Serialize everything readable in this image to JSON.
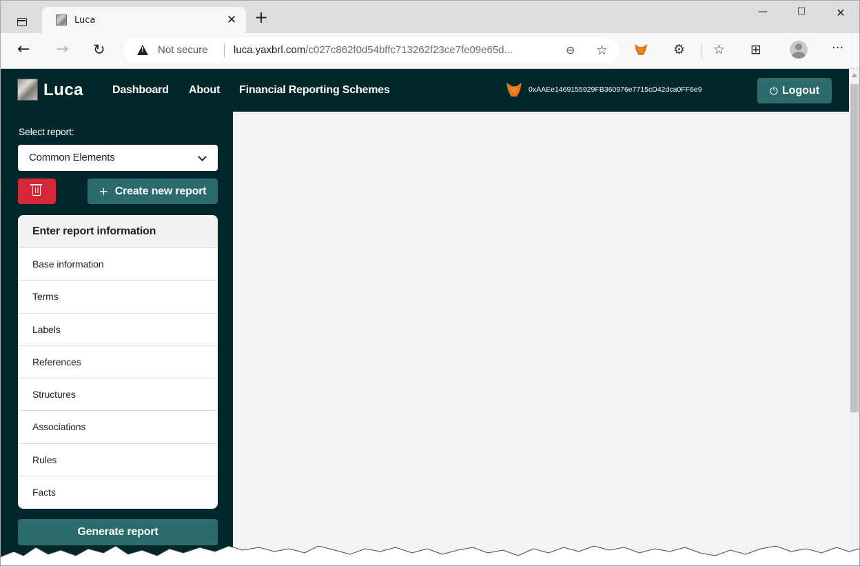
{
  "browser": {
    "tab_title": "Luca",
    "address": {
      "security_label": "Not secure",
      "host": "luca.yaxbrl.com",
      "path": "/c027c862f0d54bffc713262f23ce7fe09e65d..."
    }
  },
  "header": {
    "brand": "Luca",
    "nav": {
      "dashboard": "Dashboard",
      "about": "About",
      "frs": "Financial Reporting Schemes"
    },
    "wallet_address": "0xAAEe1469155929FB360976e7715cD42dca0FF6e9",
    "logout_label": "Logout"
  },
  "sidebar": {
    "select_label": "Select report:",
    "selected_report": "Common Elements",
    "create_label": "Create new report",
    "card_title": "Enter report information",
    "items": [
      "Base information",
      "Terms",
      "Labels",
      "References",
      "Structures",
      "Associations",
      "Rules",
      "Facts"
    ],
    "generate_label": "Generate report"
  },
  "colors": {
    "header_bg": "#00282a",
    "accent": "#2b6b6c",
    "danger": "#d62839",
    "main_bg": "#f3f3f4"
  },
  "icons": {
    "tab_actions": "tab-actions-icon",
    "favicon": "luca-favicon",
    "close": "close-icon",
    "new_tab": "plus-icon",
    "back": "back-arrow-icon",
    "forward": "forward-arrow-icon",
    "reload": "reload-icon",
    "warning": "warning-icon",
    "zoom": "zoom-out-icon",
    "add_favorite": "add-favorite-icon",
    "metamask": "metamask-fox-icon",
    "extensions": "extensions-icon",
    "favorites": "favorites-icon",
    "collections": "collections-icon",
    "profile": "profile-icon",
    "more": "more-icon",
    "power": "power-icon",
    "trash": "trash-icon",
    "chevron": "chevron-down-icon"
  }
}
